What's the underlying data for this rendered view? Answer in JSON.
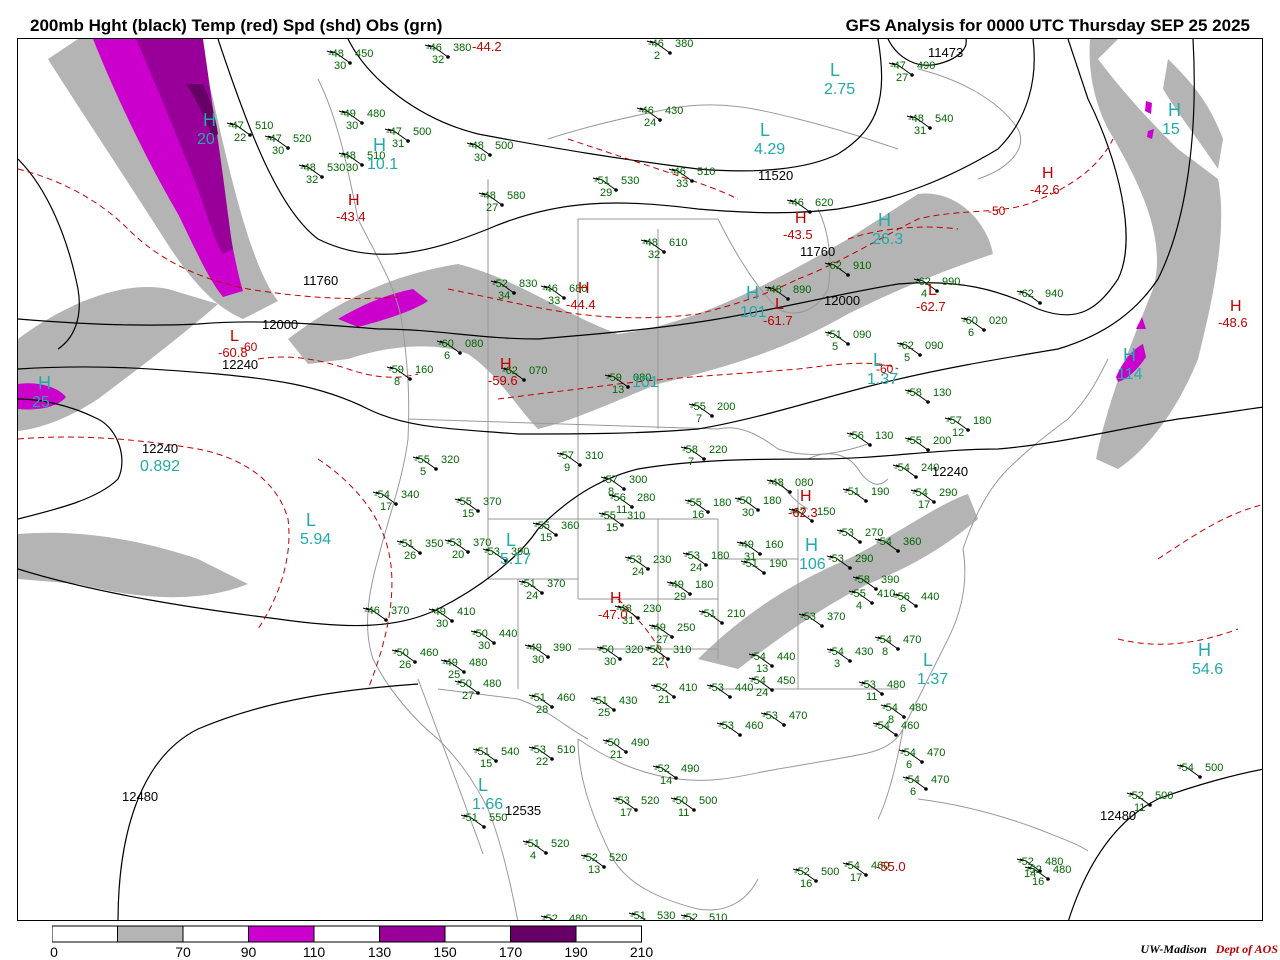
{
  "header": {
    "left_title": "200mb Hght (black) Temp (red) Spd (shd) Obs (grn)",
    "right_title": "GFS Analysis for 0000 UTC Thursday  SEP 25 2025"
  },
  "colors": {
    "height_contour": "#000000",
    "temperature_contour": "#c00000",
    "obs": "#006600",
    "center_label": "#22aaaa",
    "geography": "#999999",
    "speed_70_90": "#b4b4b4",
    "speed_90_110": "#ffffff",
    "speed_110_130": "#cc00cc",
    "speed_130_150": "#ffffff",
    "speed_150_170": "#990099",
    "speed_170_190": "#ffffff",
    "speed_190_210": "#660066"
  },
  "colorbar": {
    "ticks": [
      "0",
      "70",
      "90",
      "110",
      "130",
      "150",
      "170",
      "190",
      "210"
    ]
  },
  "height_labels": [
    "11760",
    "12000",
    "12240",
    "12240",
    "11520",
    "11760",
    "12000",
    "12480",
    "12480",
    "11473",
    "12535",
    "12240"
  ],
  "centers": [
    {
      "letter": "L",
      "value": "4.29"
    },
    {
      "letter": "L",
      "value": "2.75"
    },
    {
      "letter": "H",
      "value": "15"
    },
    {
      "letter": "H",
      "value": "20"
    },
    {
      "letter": "H",
      "value": "10.1"
    },
    {
      "letter": "H",
      "value": "26.3"
    },
    {
      "letter": "H",
      "value": "101"
    },
    {
      "letter": "L",
      "value": "1.37"
    },
    {
      "letter": "H",
      "value": "114"
    },
    {
      "letter": "H",
      "value": "25"
    },
    {
      "letter": "",
      "value": "0.892"
    },
    {
      "letter": "L",
      "value": "5.94"
    },
    {
      "letter": "L",
      "value": "5.17"
    },
    {
      "letter": "H",
      "value": "106"
    },
    {
      "letter": "L",
      "value": "1.37"
    },
    {
      "letter": "H",
      "value": "54.6"
    },
    {
      "letter": "L",
      "value": "1.66"
    },
    {
      "letter": "",
      "value": "101"
    }
  ],
  "temp_extrema": [
    {
      "letter": "H",
      "value": "-43.4"
    },
    {
      "letter": "H",
      "value": "-44.4"
    },
    {
      "letter": "H",
      "value": "-59.6"
    },
    {
      "letter": "H",
      "value": "-43.5"
    },
    {
      "letter": "L",
      "value": "-61.7"
    },
    {
      "letter": "L",
      "value": "-62.7"
    },
    {
      "letter": "H",
      "value": "-42.6"
    },
    {
      "letter": "H",
      "value": "-48.6"
    },
    {
      "letter": "H",
      "value": "-47.0"
    },
    {
      "letter": "H",
      "value": "-62.3"
    },
    {
      "letter": "L",
      "value": "-60.8"
    },
    {
      "letter": "",
      "value": "-55.0"
    },
    {
      "letter": "",
      "value": "-44.2"
    }
  ],
  "temp_labels": [
    "-60",
    "-50",
    "-60"
  ],
  "obs": [
    {
      "t": "-48",
      "h": "450",
      "s": "30"
    },
    {
      "t": "-46",
      "h": "380",
      "s": "32"
    },
    {
      "t": "-49",
      "h": "480",
      "s": "30"
    },
    {
      "t": "-47",
      "h": "510",
      "s": "22"
    },
    {
      "t": "-47",
      "h": "520",
      "s": "30"
    },
    {
      "t": "-47",
      "h": "500",
      "s": "31"
    },
    {
      "t": "-48",
      "h": "510",
      "s": "30"
    },
    {
      "t": "-48",
      "h": "530",
      "s": "32"
    },
    {
      "t": "-48",
      "h": "500",
      "s": "30"
    },
    {
      "t": "-46",
      "h": "430",
      "s": "24"
    },
    {
      "t": "-46",
      "h": "380",
      "s": "2"
    },
    {
      "t": "-51",
      "h": "530",
      "s": "29"
    },
    {
      "t": "-46",
      "h": "510",
      "s": "33"
    },
    {
      "t": "-48",
      "h": "580",
      "s": "27"
    },
    {
      "t": "-46",
      "h": "620",
      "s": ""
    },
    {
      "t": "-48",
      "h": "610",
      "s": "32"
    },
    {
      "t": "-46",
      "h": "680",
      "s": "33"
    },
    {
      "t": "-48",
      "h": "540",
      "s": "31"
    },
    {
      "t": "-47",
      "h": "490",
      "s": "27"
    },
    {
      "t": "-52",
      "h": "830",
      "s": "34"
    },
    {
      "t": "-48",
      "h": "890",
      "s": ""
    },
    {
      "t": "-62",
      "h": "910",
      "s": ""
    },
    {
      "t": "-62",
      "h": "990",
      "s": "4"
    },
    {
      "t": "-62",
      "h": "940",
      "s": ""
    },
    {
      "t": "-60",
      "h": "020",
      "s": "6"
    },
    {
      "t": "-60",
      "h": "080",
      "s": "6"
    },
    {
      "t": "-51",
      "h": "090",
      "s": "5"
    },
    {
      "t": "-62",
      "h": "090",
      "s": "5"
    },
    {
      "t": "-59",
      "h": "160",
      "s": "8"
    },
    {
      "t": "-62",
      "h": "070",
      "s": ""
    },
    {
      "t": "-59",
      "h": "080",
      "s": "13"
    },
    {
      "t": "-55",
      "h": "200",
      "s": "7"
    },
    {
      "t": "-58",
      "h": "130",
      "s": ""
    },
    {
      "t": "-57",
      "h": "180",
      "s": "12"
    },
    {
      "t": "-56",
      "h": "130",
      "s": ""
    },
    {
      "t": "-55",
      "h": "200",
      "s": ""
    },
    {
      "t": "-58",
      "h": "220",
      "s": "7"
    },
    {
      "t": "-57",
      "h": "310",
      "s": "9"
    },
    {
      "t": "-55",
      "h": "320",
      "s": "5"
    },
    {
      "t": "-57",
      "h": "300",
      "s": "8"
    },
    {
      "t": "-56",
      "h": "280",
      "s": "11"
    },
    {
      "t": "-55",
      "h": "180",
      "s": "16"
    },
    {
      "t": "-50",
      "h": "180",
      "s": "30"
    },
    {
      "t": "-48",
      "h": "080",
      "s": ""
    },
    {
      "t": "-47",
      "h": "150",
      "s": ""
    },
    {
      "t": "-51",
      "h": "190",
      "s": ""
    },
    {
      "t": "-54",
      "h": "290",
      "s": "17"
    },
    {
      "t": "-54",
      "h": "240",
      "s": ""
    },
    {
      "t": "-54",
      "h": "340",
      "s": "17"
    },
    {
      "t": "-55",
      "h": "370",
      "s": "15"
    },
    {
      "t": "-55",
      "h": "360",
      "s": "15"
    },
    {
      "t": "-55",
      "h": "310",
      "s": "15"
    },
    {
      "t": "-51",
      "h": "350",
      "s": "26"
    },
    {
      "t": "-53",
      "h": "370",
      "s": "20"
    },
    {
      "t": "-53",
      "h": "390",
      "s": ""
    },
    {
      "t": "-53",
      "h": "230",
      "s": "24"
    },
    {
      "t": "-53",
      "h": "180",
      "s": "24"
    },
    {
      "t": "-49",
      "h": "160",
      "s": "31"
    },
    {
      "t": "-51",
      "h": "190",
      "s": ""
    },
    {
      "t": "-53",
      "h": "270",
      "s": ""
    },
    {
      "t": "-53",
      "h": "290",
      "s": ""
    },
    {
      "t": "-54",
      "h": "360",
      "s": ""
    },
    {
      "t": "-51",
      "h": "370",
      "s": "24"
    },
    {
      "t": "-46",
      "h": "370",
      "s": ""
    },
    {
      "t": "-49",
      "h": "410",
      "s": "30"
    },
    {
      "t": "-50",
      "h": "440",
      "s": "30"
    },
    {
      "t": "-48",
      "h": "230",
      "s": "31"
    },
    {
      "t": "-49",
      "h": "180",
      "s": "29"
    },
    {
      "t": "-49",
      "h": "250",
      "s": "27"
    },
    {
      "t": "-51",
      "h": "210",
      "s": ""
    },
    {
      "t": "-53",
      "h": "370",
      "s": ""
    },
    {
      "t": "-58",
      "h": "390",
      "s": ""
    },
    {
      "t": "-55",
      "h": "410",
      "s": "4"
    },
    {
      "t": "-56",
      "h": "440",
      "s": "6"
    },
    {
      "t": "-50",
      "h": "460",
      "s": "26"
    },
    {
      "t": "-49",
      "h": "480",
      "s": "25"
    },
    {
      "t": "-49",
      "h": "390",
      "s": "30"
    },
    {
      "t": "-50",
      "h": "320",
      "s": "30"
    },
    {
      "t": "-50",
      "h": "310",
      "s": "22"
    },
    {
      "t": "-54",
      "h": "440",
      "s": "13"
    },
    {
      "t": "-54",
      "h": "430",
      "s": "3"
    },
    {
      "t": "-54",
      "h": "470",
      "s": "8"
    },
    {
      "t": "-50",
      "h": "480",
      "s": "27"
    },
    {
      "t": "-51",
      "h": "460",
      "s": "28"
    },
    {
      "t": "-51",
      "h": "430",
      "s": "25"
    },
    {
      "t": "-52",
      "h": "410",
      "s": "21"
    },
    {
      "t": "-53",
      "h": "440",
      "s": ""
    },
    {
      "t": "-54",
      "h": "450",
      "s": "24"
    },
    {
      "t": "-53",
      "h": "480",
      "s": "11"
    },
    {
      "t": "-53",
      "h": "460",
      "s": ""
    },
    {
      "t": "-53",
      "h": "470",
      "s": ""
    },
    {
      "t": "-54",
      "h": "480",
      "s": "8"
    },
    {
      "t": "-54",
      "h": "460",
      "s": ""
    },
    {
      "t": "-51",
      "h": "540",
      "s": "15"
    },
    {
      "t": "-53",
      "h": "510",
      "s": "22"
    },
    {
      "t": "-50",
      "h": "490",
      "s": "21"
    },
    {
      "t": "-52",
      "h": "490",
      "s": "14"
    },
    {
      "t": "-54",
      "h": "470",
      "s": "6"
    },
    {
      "t": "-54",
      "h": "470",
      "s": "6"
    },
    {
      "t": "-54",
      "h": "500",
      "s": ""
    },
    {
      "t": "-52",
      "h": "500",
      "s": "11"
    },
    {
      "t": "-53",
      "h": "520",
      "s": "17"
    },
    {
      "t": "-50",
      "h": "500",
      "s": "11"
    },
    {
      "t": "-51",
      "h": "550",
      "s": ""
    },
    {
      "t": "-51",
      "h": "520",
      "s": "4"
    },
    {
      "t": "-52",
      "h": "520",
      "s": "13"
    },
    {
      "t": "-52",
      "h": "500",
      "s": "16"
    },
    {
      "t": "-52",
      "h": "480",
      "s": "14"
    },
    {
      "t": "-52",
      "h": "480",
      "s": "16"
    },
    {
      "t": "-54",
      "h": "460",
      "s": "17"
    },
    {
      "t": "-52",
      "h": "480",
      "s": ""
    },
    {
      "t": "-51",
      "h": "530",
      "s": ""
    },
    {
      "t": "-52",
      "h": "510",
      "s": ""
    },
    {
      "t": "-52",
      "h": "480",
      "s": ""
    }
  ],
  "credit": {
    "institution": "UW-Madison",
    "dept": "Dept of AOS"
  }
}
